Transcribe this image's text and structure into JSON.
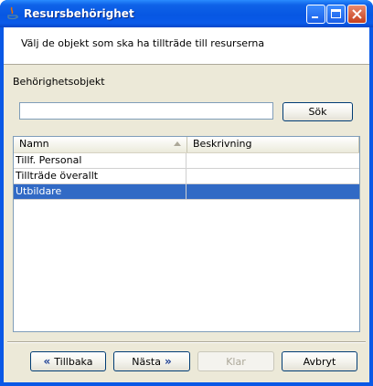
{
  "window": {
    "title": "Resursbehörighet"
  },
  "header": {
    "instruction": "Välj de objekt som ska ha tillträde till resurserna"
  },
  "search": {
    "section_label": "Behörighetsobjekt",
    "value": "",
    "button_label": "Sök"
  },
  "table": {
    "columns": [
      "Namn",
      "Beskrivning"
    ],
    "sort_column": "Namn",
    "rows": [
      {
        "name": "Tillf. Personal",
        "description": ""
      },
      {
        "name": "Tillträde överallt",
        "description": ""
      },
      {
        "name": "Utbildare",
        "description": "",
        "selected": true
      }
    ]
  },
  "footer": {
    "back_label": "Tillbaka",
    "next_label": "Nästa",
    "finish_label": "Klar",
    "cancel_label": "Avbryt"
  },
  "colors": {
    "titlebar": "#0A58E6",
    "selection": "#316AC5",
    "dialog_bg": "#ECE9D8"
  }
}
